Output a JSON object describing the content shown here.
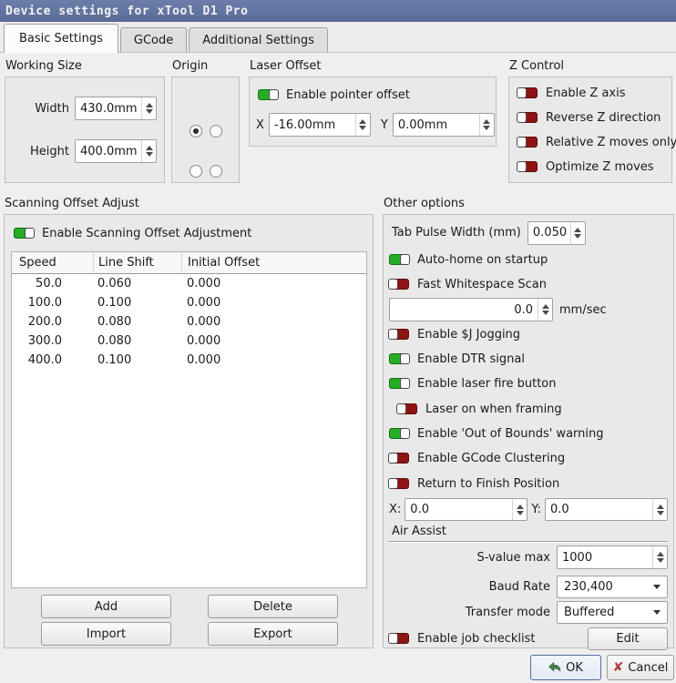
{
  "window": {
    "title": "Device settings for xTool D1 Pro"
  },
  "tabs": [
    {
      "label": "Basic Settings",
      "active": true
    },
    {
      "label": "GCode",
      "active": false
    },
    {
      "label": "Additional Settings",
      "active": false
    }
  ],
  "working_size": {
    "title": "Working Size",
    "width_label": "Width",
    "width_value": "430.0mm",
    "height_label": "Height",
    "height_value": "400.0mm"
  },
  "origin": {
    "title": "Origin",
    "options": [
      {
        "name": "top-left",
        "selected": true
      },
      {
        "name": "top-right",
        "selected": false
      },
      {
        "name": "bottom-left",
        "selected": false
      },
      {
        "name": "bottom-right",
        "selected": false
      }
    ]
  },
  "laser_offset": {
    "title": "Laser Offset",
    "pointer_toggle": {
      "label": "Enable pointer offset",
      "on": true
    },
    "x_label": "X",
    "x_value": "-16.00mm",
    "y_label": "Y",
    "y_value": "0.00mm"
  },
  "z_control": {
    "title": "Z Control",
    "toggles": [
      {
        "label": "Enable Z axis",
        "on": false
      },
      {
        "label": "Reverse Z direction",
        "on": false
      },
      {
        "label": "Relative Z moves only",
        "on": false
      },
      {
        "label": "Optimize Z moves",
        "on": false
      }
    ]
  },
  "scanning": {
    "title": "Scanning Offset Adjust",
    "enable_toggle": {
      "label": "Enable Scanning Offset Adjustment",
      "on": true
    },
    "table": {
      "headers": [
        "Speed",
        "Line Shift",
        "Initial Offset"
      ],
      "rows": [
        [
          "50.0",
          "0.060",
          "0.000"
        ],
        [
          "100.0",
          "0.100",
          "0.000"
        ],
        [
          "200.0",
          "0.080",
          "0.000"
        ],
        [
          "300.0",
          "0.080",
          "0.000"
        ],
        [
          "400.0",
          "0.100",
          "0.000"
        ]
      ]
    },
    "buttons": {
      "add": "Add",
      "delete": "Delete",
      "import": "Import",
      "export": "Export"
    }
  },
  "other": {
    "title": "Other options",
    "tab_pulse": {
      "label": "Tab Pulse Width (mm)",
      "value": "0.050"
    },
    "auto_home": {
      "label": "Auto-home on startup",
      "on": true
    },
    "fast_whitespace": {
      "label": "Fast Whitespace Scan",
      "on": false
    },
    "whitespace_speed": {
      "value": "0.0",
      "unit": "mm/sec"
    },
    "jogging": {
      "label": "Enable $J Jogging",
      "on": false
    },
    "dtr": {
      "label": "Enable DTR signal",
      "on": true
    },
    "laser_fire": {
      "label": "Enable laser fire button",
      "on": true
    },
    "framing": {
      "label": "Laser on when framing",
      "on": false
    },
    "out_of_bounds": {
      "label": "Enable 'Out of Bounds' warning",
      "on": true
    },
    "clustering": {
      "label": "Enable GCode Clustering",
      "on": false
    },
    "return_finish": {
      "label": "Return to Finish Position",
      "on": false
    },
    "finish_x_label": "X:",
    "finish_x_value": "0.0",
    "finish_y_label": "Y:",
    "finish_y_value": "0.0",
    "air_assist_label": "Air Assist",
    "s_value": {
      "label": "S-value max",
      "value": "1000"
    },
    "baud": {
      "label": "Baud Rate",
      "value": "230,400"
    },
    "transfer": {
      "label": "Transfer mode",
      "value": "Buffered"
    },
    "checklist": {
      "label": "Enable job checklist",
      "button_label": "Edit"
    }
  },
  "footer": {
    "ok_label": "OK",
    "cancel_label": "Cancel"
  },
  "colors": {
    "toggle_on": "#25ad25",
    "toggle_off": "#8e1414",
    "titlebar": "#6277a3",
    "accent_border": "#50719d"
  }
}
